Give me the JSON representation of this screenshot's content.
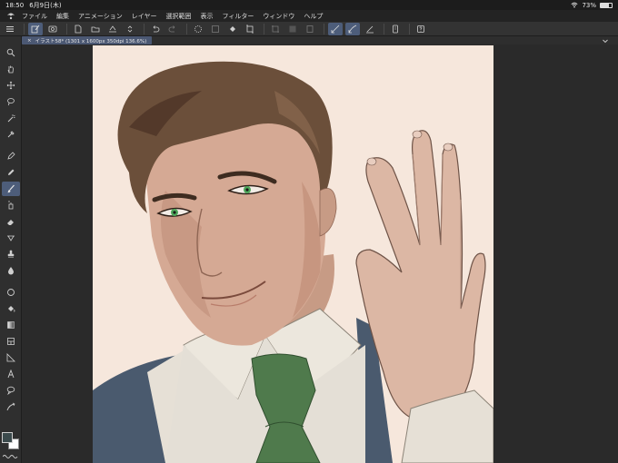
{
  "status": {
    "time": "18:50",
    "date": "6月9日(木)",
    "wifi_icon": "wifi-icon",
    "battery_percent": "73%",
    "battery_level": 0.73
  },
  "menu": {
    "items": [
      "ファイル",
      "編集",
      "アニメーション",
      "レイヤー",
      "選択範囲",
      "表示",
      "フィルター",
      "ウィンドウ",
      "ヘルプ"
    ]
  },
  "document": {
    "tab_label": "イラスト58* (1301 x 1600px 350dpi 136.6%)"
  },
  "colors": {
    "accent": "#4d5d7a",
    "main_color": "#3b4a4c",
    "sub_color": "#ffffff",
    "canvas_bg": "#f6e6da"
  }
}
